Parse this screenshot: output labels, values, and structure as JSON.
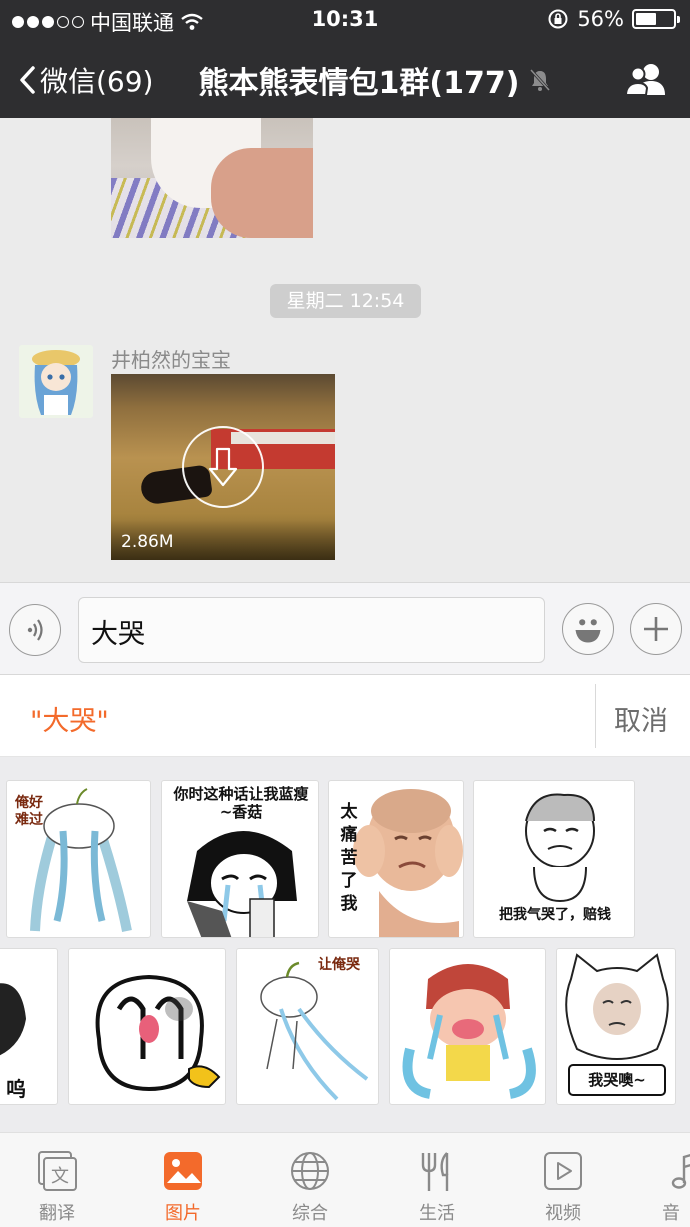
{
  "status": {
    "carrier": "中国联通",
    "time": "10:31",
    "battery": "56%",
    "battery_level": 0.56
  },
  "nav": {
    "back_label": "微信(69)",
    "title": "熊本熊表情包1群(177)"
  },
  "chat": {
    "timestamp": "星期二 12:54",
    "sender": "井柏然的宝宝",
    "video_size": "2.86M"
  },
  "input": {
    "text": "大哭"
  },
  "search": {
    "query": "\"大哭\"",
    "cancel": "取消"
  },
  "stickers": {
    "s2_caption": "你时这种话让我蓝瘦~香菇",
    "s3_caption": "太痛苦了我",
    "s4_caption": "把我气哭了，赔钱",
    "s1_caption": "俺好难过",
    "r5_caption": "呜",
    "s7_caption": "让俺哭",
    "s9_caption": "我哭噢~"
  },
  "tabs": [
    {
      "label": "翻译",
      "icon": "translate-icon"
    },
    {
      "label": "图片",
      "icon": "image-icon"
    },
    {
      "label": "综合",
      "icon": "globe-icon"
    },
    {
      "label": "生活",
      "icon": "fork-knife-icon"
    },
    {
      "label": "视频",
      "icon": "video-icon"
    },
    {
      "label": "音",
      "icon": "music-icon"
    }
  ],
  "colors": {
    "accent": "#f36a2b",
    "nav_bg": "#2e2e30"
  }
}
